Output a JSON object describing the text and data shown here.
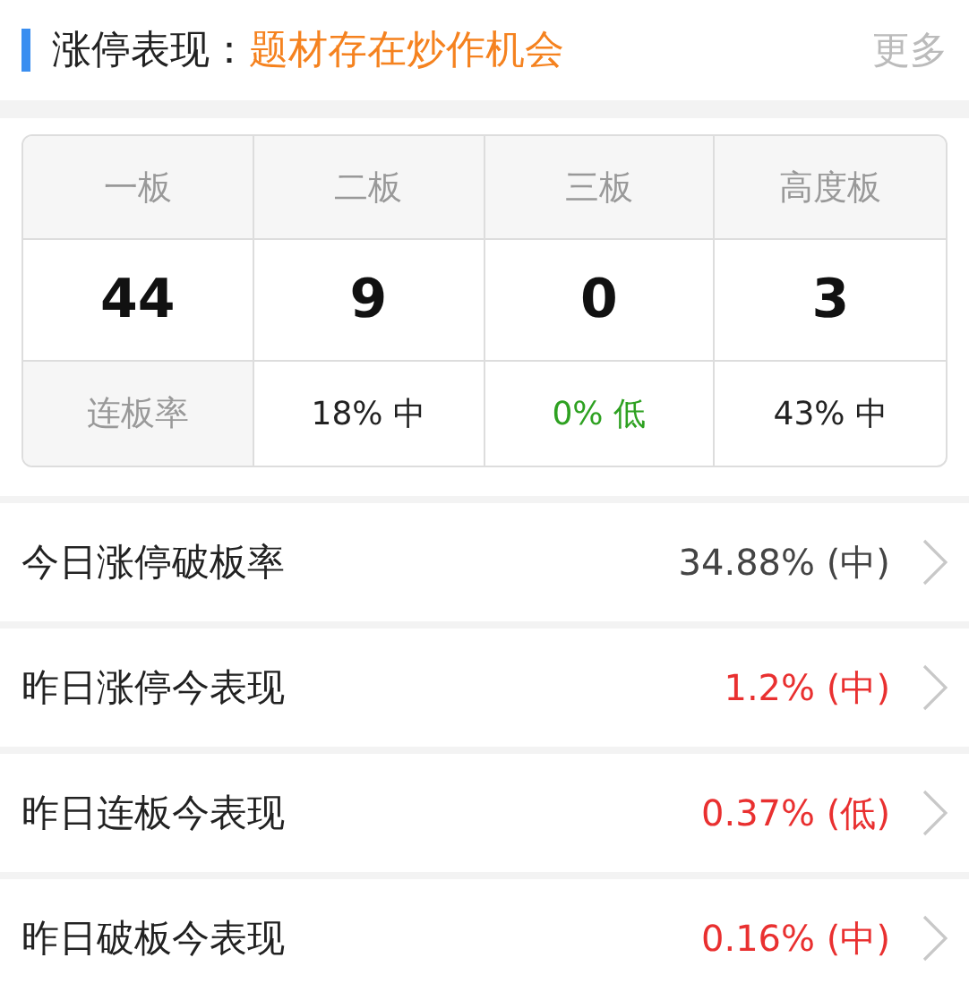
{
  "header": {
    "title": "涨停表现：",
    "highlight": "题材存在炒作机会",
    "more": "更多"
  },
  "board_table": {
    "columns": [
      "一板",
      "二板",
      "三板",
      "高度板"
    ],
    "counts": [
      "44",
      "9",
      "0",
      "3"
    ],
    "rate_label": "连板率",
    "rates": [
      {
        "text": "18% 中",
        "color": "#222222"
      },
      {
        "text": "0% 低",
        "color": "#2ea121"
      },
      {
        "text": "43% 中",
        "color": "#222222"
      }
    ]
  },
  "rows": [
    {
      "label": "今日涨停破板率",
      "value": "34.88% (中)",
      "color": "#444444"
    },
    {
      "label": "昨日涨停今表现",
      "value": "1.2% (中)",
      "color": "#e93030"
    },
    {
      "label": "昨日连板今表现",
      "value": "0.37% (低)",
      "color": "#e93030"
    },
    {
      "label": "昨日破板今表现",
      "value": "0.16% (中)",
      "color": "#e93030"
    }
  ]
}
